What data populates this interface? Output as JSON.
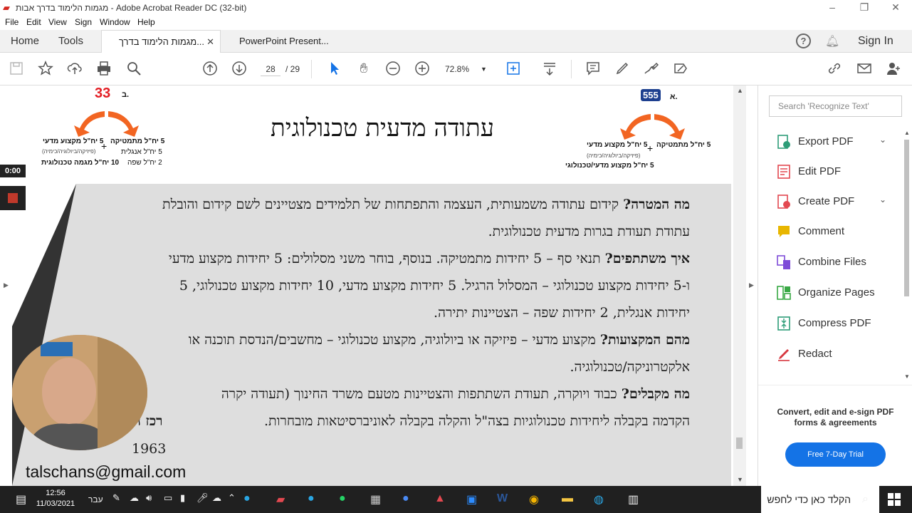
{
  "window": {
    "title": "מגמות הלימוד בדרך אבות - Adobe Acrobat Reader DC (32-bit)",
    "minimize": "–",
    "maximize": "❐",
    "close": "✕"
  },
  "menu": [
    "File",
    "Edit",
    "View",
    "Sign",
    "Window",
    "Help"
  ],
  "tabs": {
    "home": "Home",
    "tools": "Tools",
    "doc1": "מגמות הלימוד בדרך...",
    "doc2": "PowerPoint Present...",
    "close": "✕",
    "sign_in": "Sign In",
    "help": "?"
  },
  "toolbar": {
    "page_current": "28",
    "page_total": "/ 29",
    "zoom": "72.8%"
  },
  "right_panel": {
    "search_placeholder": "Search 'Recognize Text'",
    "items": [
      {
        "label": "Export PDF",
        "color": "#2d9d78"
      },
      {
        "label": "Edit PDF",
        "color": "#e34850"
      },
      {
        "label": "Create PDF",
        "color": "#e34850"
      },
      {
        "label": "Comment",
        "color": "#e8b600"
      },
      {
        "label": "Combine Files",
        "color": "#7e4cd8"
      },
      {
        "label": "Organize Pages",
        "color": "#38a844"
      },
      {
        "label": "Compress PDF",
        "color": "#2d9d78"
      },
      {
        "label": "Redact",
        "color": "#d7373f"
      }
    ],
    "promo_text": "Convert, edit and e-sign PDF forms & agreements",
    "trial_button": "Free 7-Day Trial"
  },
  "document": {
    "heading": "עתודה מדעית טכנולוגית",
    "badge_left": "33",
    "badge_left_letter": "ב.",
    "badge_right": "555",
    "badge_right_letter": "א.",
    "left_col1": [
      "5 יח\"ל מקצוע מדעי",
      "(פיזיקה/ביולוגיה/כימיה)",
      "10 יח\"ל מגמה טכנולוגית"
    ],
    "left_col2": [
      "5 יח\"ל מתמטיקה",
      "5 יח\"ל אנגלית",
      "2 יח\"ל שפה"
    ],
    "right_col1": [
      "5 יח\"ל מקצוע מדעי",
      "(פיזיקה/ביולוגיה/כימיה)",
      "5 יח\"ל מקצוע מדעי/טכנולוגי"
    ],
    "right_col2": [
      "5 יח\"ל מתמטיקה"
    ],
    "lines": [
      {
        "bold": "מה המטרה?",
        "text": " קידום עתודה משמעותית, העצמה והתפתחות של תלמידים מצטיינים לשם קידום והובלת"
      },
      {
        "bold": "",
        "text": "עתודת תעודת בגרות מדעית טכנולוגית."
      },
      {
        "bold": "איך משתתפים?",
        "text": " תנאי סף – 5 יחידות מתמטיקה. בנוסף, בוחר משני מסלולים: 5 יחידות מקצוע מדעי"
      },
      {
        "bold": "",
        "text": "ו-5 יחידות מקצוע טכנולוגי – המסלול הרגיל. 5 יחידות מקצוע מדעי, 10 יחידות מקצוע טכנולוגי, 5"
      },
      {
        "bold": "",
        "text": "יחידות אנגלית, 2 יחידות שפה – הצטיינות יתירה."
      },
      {
        "bold": "מהם המקצועות?",
        "text": " מקצוע מדעי – פיזיקה או ביולוגיה, מקצוע טכנולוגי – מחשבים/הנדסת תוכנה או"
      },
      {
        "bold": "",
        "text": "אלקטרוניקה/טכנולוגיה."
      },
      {
        "bold": "מה מקבלים?",
        "text": " כבוד ויוקרה, תעודת השתתפות והצטיינות מטעם משרד החינוך (תעודה יקרה"
      },
      {
        "bold": "",
        "text": "הקדמה בקבלה ליחידות טכנולוגיות בצה\"ל והקלה בקבלה לאוניברסיטאות מובחרות."
      }
    ],
    "partial_bold": "רכז ה",
    "partial_year": "1963"
  },
  "overlay": {
    "timer": "0:00",
    "email": "talschans@gmail.com"
  },
  "taskbar": {
    "time": "12:56",
    "date": "11/03/2021",
    "lang": "עבר",
    "search": "הקלד כאן כדי לחפש"
  }
}
